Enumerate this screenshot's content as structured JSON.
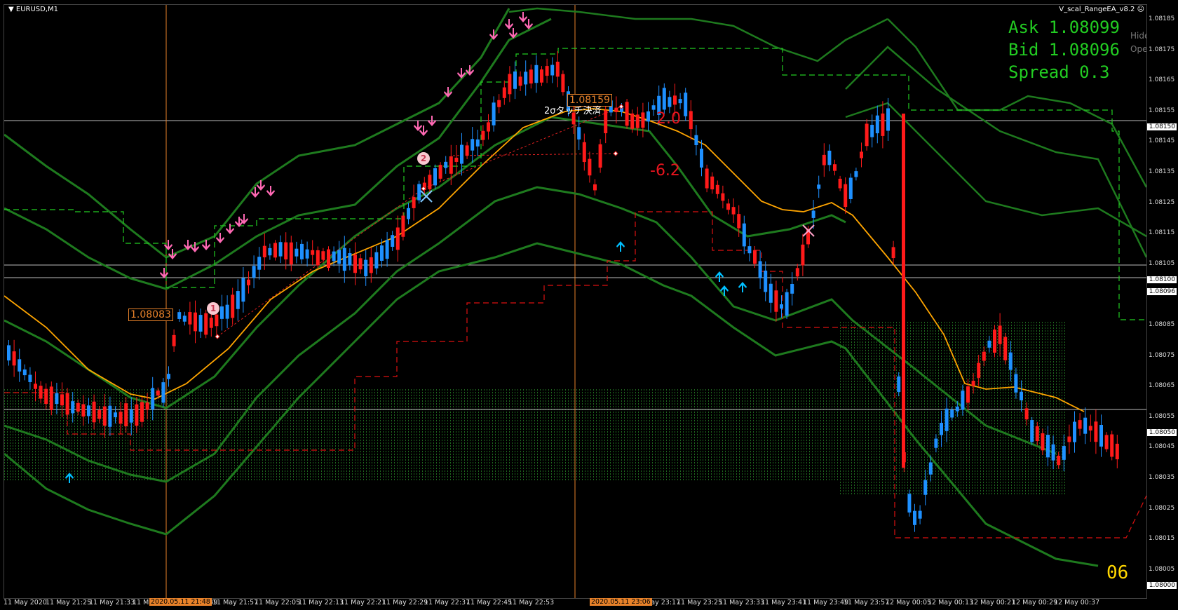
{
  "window": {
    "symbol": "EURUSD,M1",
    "ea_name": "V_scal_RangeEA_v8.2",
    "menu_arrow": "▼",
    "face_glyph": "☹"
  },
  "hud": {
    "ask": "Ask 1.08099",
    "bid": "Bid 1.08096",
    "spread": "Spread 0.3",
    "hide_button": "Hide",
    "open_button": "Open"
  },
  "chart_labels": {
    "entry_price_1": "1.08083",
    "entry_price_2": "1.08159",
    "touch_note": "2σタッチ決済",
    "profit_value": "2.0",
    "loss_value": "-6.2",
    "marker_1": "1",
    "marker_2": "2",
    "corner_number": "06"
  },
  "price_axis": {
    "ticks": [
      "1.08185",
      "1.08175",
      "1.08165",
      "1.08155",
      "1.08145",
      "1.08135",
      "1.08125",
      "1.08115",
      "1.08105",
      "1.08095",
      "1.08085",
      "1.08075",
      "1.08065",
      "1.08055",
      "1.08045",
      "1.08035",
      "1.08025",
      "1.08015",
      "1.08005"
    ],
    "highlighted": [
      "1.08150",
      "1.08100",
      "1.08096",
      "1.08050",
      "1.08000"
    ]
  },
  "time_axis": {
    "ticks": [
      "11 May 2020",
      "11 May 21:25",
      "11 May 21:33",
      "11 M",
      "21:49",
      "11 May 21:57",
      "11 May 22:05",
      "11 May 22:13",
      "11 May 22:21",
      "11 May 22:29",
      "11 May 22:37",
      "11 May 22:45",
      "11 May 22:53",
      "23:09",
      "11 May 23:17",
      "11 May 23:25",
      "11 May 23:33",
      "11 May 23:41",
      "11 May 23:49",
      "11 May 23:57",
      "12 May 00:05",
      "12 May 00:13",
      "12 May 00:21",
      "12 May 00:29",
      "12 May 00:37"
    ],
    "highlighted": [
      "2020.05.11 21:48",
      "2020.05.11 23:06"
    ]
  },
  "colors": {
    "background": "#000000",
    "bull_candle": "#1e90ff",
    "bear_candle": "#ff1a1a",
    "bollinger": "#1e7a1e",
    "moving_average": "#ffa500",
    "dashed_green": "#22cc22",
    "dashed_red": "#d11",
    "hud_text": "#22cc22",
    "sell_arrow": "#ff69b4",
    "buy_arrow": "#00bfff"
  }
}
